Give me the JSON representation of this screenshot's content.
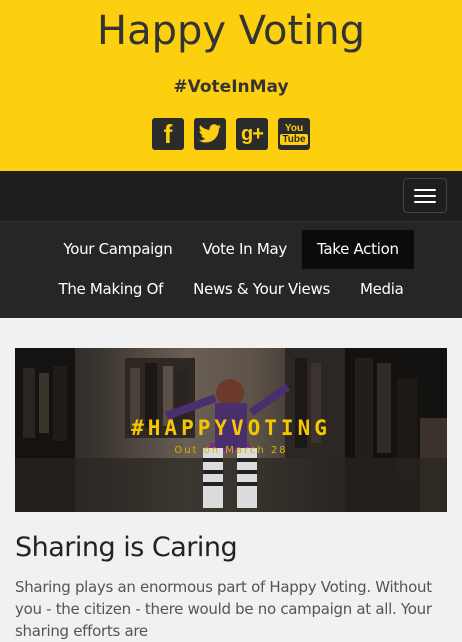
{
  "header": {
    "title": "Happy Voting",
    "tagline": "#VoteInMay",
    "social": [
      {
        "icon": "facebook-icon",
        "glyph": "f"
      },
      {
        "icon": "twitter-icon",
        "glyph": "🐦"
      },
      {
        "icon": "google-plus-icon",
        "glyph": "g+"
      },
      {
        "icon": "youtube-icon",
        "glyph": "You",
        "glyph2": "Tube"
      }
    ],
    "accent": "#fdd00f"
  },
  "nav": {
    "row1": [
      "Your Campaign",
      "Vote In May",
      "Take Action"
    ],
    "row2": [
      "The Making Of",
      "News & Your Views",
      "Media"
    ],
    "active": "Take Action"
  },
  "hero": {
    "title": "#HAPPYVOTING",
    "subtitle": "Out on March 28"
  },
  "article": {
    "heading": "Sharing is Caring",
    "body": "Sharing plays an enormous part of Happy Voting. Without you - the citizen - there would be no campaign at all. Your sharing efforts are"
  }
}
